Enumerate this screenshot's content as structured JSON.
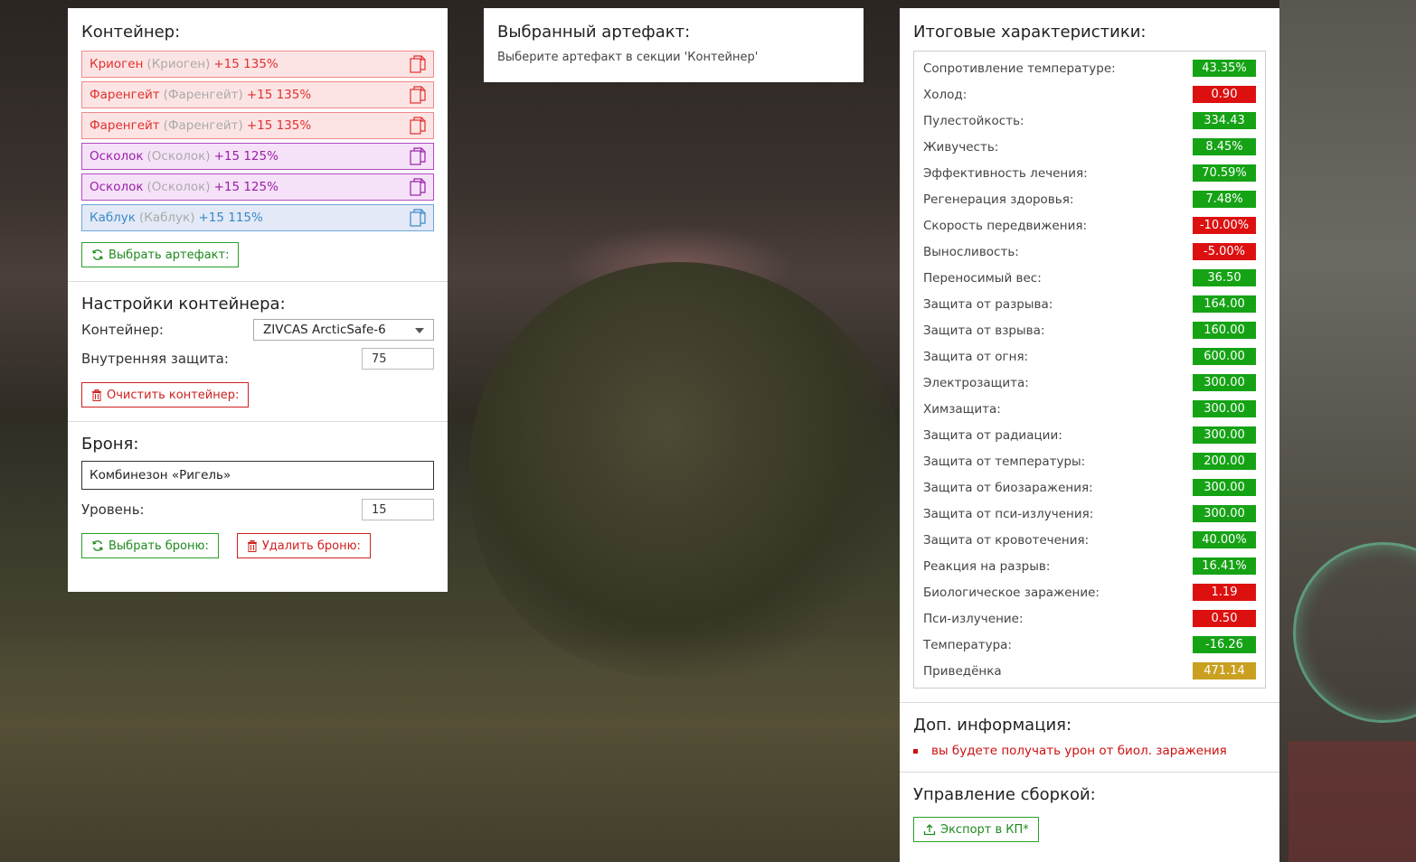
{
  "container_section": {
    "title": "Контейнер:",
    "artifacts": [
      {
        "name": "Криоген",
        "alt": "(Криоген)",
        "bonus": "+15 135%",
        "color": "red"
      },
      {
        "name": "Фаренгейт",
        "alt": "(Фаренгейт)",
        "bonus": "+15 135%",
        "color": "red"
      },
      {
        "name": "Фаренгейт",
        "alt": "(Фаренгейт)",
        "bonus": "+15 135%",
        "color": "red"
      },
      {
        "name": "Осколок",
        "alt": "(Осколок)",
        "bonus": "+15 125%",
        "color": "purple"
      },
      {
        "name": "Осколок",
        "alt": "(Осколок)",
        "bonus": "+15 125%",
        "color": "purple"
      },
      {
        "name": "Каблук",
        "alt": "(Каблук)",
        "bonus": "+15 115%",
        "color": "blue"
      }
    ],
    "select_artifact_label": "Выбрать артефакт:"
  },
  "container_settings": {
    "title": "Настройки контейнера:",
    "container_label": "Контейнер:",
    "container_value": "ZIVCAS ArcticSafe-6",
    "inner_protection_label": "Внутренняя защита:",
    "inner_protection_value": "75",
    "clear_label": "Очистить контейнер:"
  },
  "armor": {
    "title": "Броня:",
    "armor_value": "Комбинезон «Ригель»",
    "level_label": "Уровень:",
    "level_value": "15",
    "select_label": "Выбрать броню:",
    "delete_label": "Удалить броню:"
  },
  "selected_artifact": {
    "title": "Выбранный артефакт:",
    "hint": "Выберите артефакт в секции 'Контейнер'"
  },
  "totals": {
    "title": "Итоговые характеристики:",
    "stats": [
      {
        "label": "Сопротивление температуре:",
        "value": "43.35%",
        "status": "g"
      },
      {
        "label": "Холод:",
        "value": "0.90",
        "status": "r"
      },
      {
        "label": "Пулестойкость:",
        "value": "334.43",
        "status": "g"
      },
      {
        "label": "Живучесть:",
        "value": "8.45%",
        "status": "g"
      },
      {
        "label": "Эффективность лечения:",
        "value": "70.59%",
        "status": "g"
      },
      {
        "label": "Регенерация здоровья:",
        "value": "7.48%",
        "status": "g"
      },
      {
        "label": "Скорость передвижения:",
        "value": "-10.00%",
        "status": "r"
      },
      {
        "label": "Выносливость:",
        "value": "-5.00%",
        "status": "r"
      },
      {
        "label": "Переносимый вес:",
        "value": "36.50",
        "status": "g"
      },
      {
        "label": "Защита от разрыва:",
        "value": "164.00",
        "status": "g"
      },
      {
        "label": "Защита от взрыва:",
        "value": "160.00",
        "status": "g"
      },
      {
        "label": "Защита от огня:",
        "value": "600.00",
        "status": "g"
      },
      {
        "label": "Электрозащита:",
        "value": "300.00",
        "status": "g"
      },
      {
        "label": "Химзащита:",
        "value": "300.00",
        "status": "g"
      },
      {
        "label": "Защита от радиации:",
        "value": "300.00",
        "status": "g"
      },
      {
        "label": "Защита от температуры:",
        "value": "200.00",
        "status": "g"
      },
      {
        "label": "Защита от биозаражения:",
        "value": "300.00",
        "status": "g"
      },
      {
        "label": "Защита от пси-излучения:",
        "value": "300.00",
        "status": "g"
      },
      {
        "label": "Защита от кровотечения:",
        "value": "40.00%",
        "status": "g"
      },
      {
        "label": "Реакция на разрыв:",
        "value": "16.41%",
        "status": "g"
      },
      {
        "label": "Биологическое заражение:",
        "value": "1.19",
        "status": "r"
      },
      {
        "label": "Пси-излучение:",
        "value": "0.50",
        "status": "r"
      },
      {
        "label": "Температура:",
        "value": "-16.26",
        "status": "g"
      },
      {
        "label": "Приведёнка",
        "value": "471.14",
        "status": "y"
      }
    ]
  },
  "extra_info": {
    "title": "Доп. информация:",
    "items": [
      "вы будете получать урон от биол. заражения"
    ]
  },
  "build": {
    "title": "Управление сборкой:",
    "export_label": "Экспорт в КП*"
  },
  "colors": {
    "green": "#15a315",
    "red": "#dd1010",
    "yellow": "#c9a020",
    "artifact_red": "#e03030",
    "artifact_purple": "#9a20a8",
    "artifact_blue": "#3a88c8"
  }
}
